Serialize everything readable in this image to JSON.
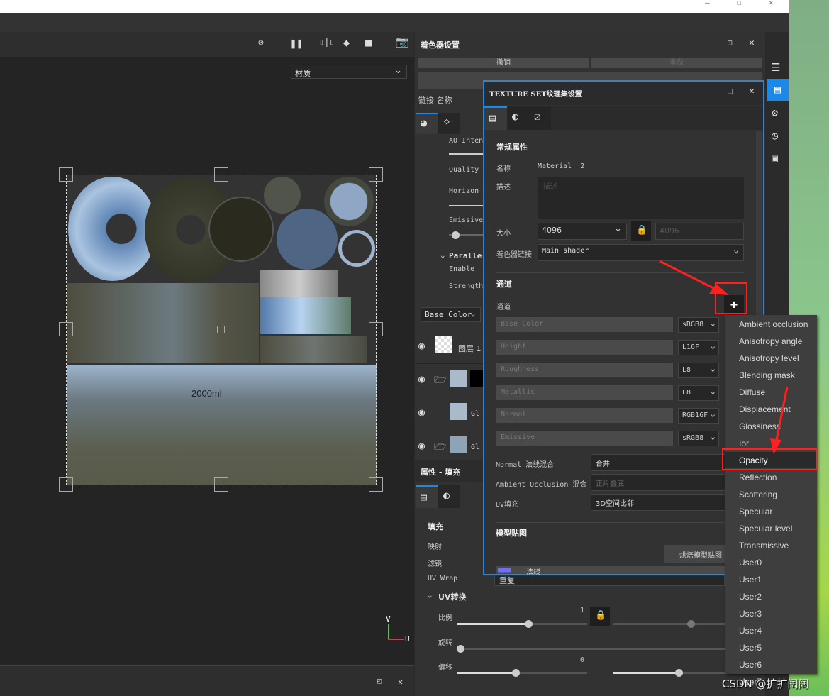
{
  "window": {
    "minimize": "—",
    "maximize": "☐",
    "close": "✕"
  },
  "viewport": {
    "channel_select": "材质",
    "texture_label": "2000ml",
    "axis_v": "V",
    "axis_u": "U"
  },
  "shader_panel": {
    "title": "着色器设置",
    "undo": "撤销",
    "redo": "重做",
    "columns": "链接 名称",
    "props": [
      "AO Inten",
      "Quality",
      "Horizon",
      "Emissive"
    ],
    "parallax": "Paralle",
    "enable": "Enable",
    "strength": "Strength",
    "channel_select": "Base Color",
    "layers": [
      {
        "name": "图层 1"
      },
      {
        "name": "Gl"
      },
      {
        "name": "Gl"
      },
      {
        "name": "Gl"
      }
    ]
  },
  "properties": {
    "title": "属性 - 填充",
    "fill": "填充",
    "mapping": "映射",
    "filter": "滤镜",
    "uv_wrap_label": "UV Wrap",
    "uv_wrap_value": "重复",
    "uv_transform": "UV转换",
    "scale": "比例",
    "scale_value": "1",
    "rotation": "旋转",
    "offset": "偏移",
    "offset_value": "0",
    "scale_pct": 0.55,
    "offset_pct": 0.45
  },
  "texture_set": {
    "title": "TEXTURE SET纹理集设置",
    "general": "常规属性",
    "name_label": "名称",
    "name_value": "Material _2",
    "desc_label": "描述",
    "desc_placeholder": "描述",
    "size_label": "大小",
    "size_value": "4096",
    "size_value2": "4096",
    "shader_link_label": "着色器链接",
    "shader_link_value": "Main shader",
    "channels_title": "通道",
    "channels_label": "通道",
    "add": "+",
    "channels": [
      {
        "name": "Base Color",
        "format": "sRGB8"
      },
      {
        "name": "Height",
        "format": "L16F"
      },
      {
        "name": "Roughness",
        "format": "L8"
      },
      {
        "name": "Metallic",
        "format": "L8"
      },
      {
        "name": "Normal",
        "format": "RGB16F"
      },
      {
        "name": "Emissive",
        "format": "sRGB8"
      }
    ],
    "normal_blend_label": "Normal 法线混合",
    "normal_blend_value": "合并",
    "ao_blend_label": "Ambient Occlusion 混合",
    "ao_blend_value": "正片叠底",
    "uv_fill_label": "UV填充",
    "uv_fill_value": "3D空间比邻",
    "mesh_maps": "模型贴图",
    "bake_button": "烘焙模型贴图",
    "normal_map": "法线"
  },
  "dropdown": {
    "items": [
      "Ambient occlusion",
      "Anisotropy angle",
      "Anisotropy level",
      "Blending mask",
      "Diffuse",
      "Displacement",
      "Glossiness",
      "Ior",
      "Opacity",
      "Reflection",
      "Scattering",
      "Specular",
      "Specular level",
      "Transmissive",
      "User0",
      "User1",
      "User2",
      "User3",
      "User4",
      "User5",
      "User6",
      "User7"
    ],
    "highlighted": "Opacity"
  },
  "watermark": "CSDN @扩扩阔阔",
  "colors": {
    "accent": "#1e88e5",
    "annotation": "#ff2020",
    "panel": "#333333"
  }
}
